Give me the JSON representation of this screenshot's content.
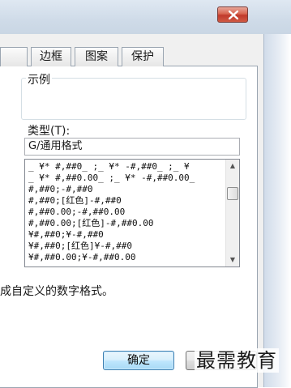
{
  "tabs": {
    "border": "边框",
    "pattern": "图案",
    "protect": "保护"
  },
  "sample": {
    "label": "示例"
  },
  "type_field": {
    "label": "类型(T):",
    "value": "G/通用格式"
  },
  "format_list": {
    "items": [
      "_ ¥* #,##0_ ;_ ¥* -#,##0_ ;_ ¥",
      "_ ¥* #,##0.00_ ;_ ¥* -#,##0.00_",
      "#,##0;-#,##0",
      "#,##0;[红色]-#,##0",
      "#,##0.00;-#,##0.00",
      "#,##0.00;[红色]-#,##0.00",
      "¥#,##0;¥-#,##0",
      "¥#,##0;[红色]¥-#,##0",
      "¥#,##0.00;¥-#,##0.00"
    ]
  },
  "description": "成自定义的数字格式。",
  "buttons": {
    "ok": "确定"
  },
  "watermark": "最需教育",
  "colors": {
    "close_button": "#c0392b",
    "ok_button_border": "#3c7fb1",
    "dialog_background": "#f0f0f0"
  },
  "icons": {
    "close": "close-icon",
    "scroll_up": "scroll-up-arrow-icon",
    "scroll_down": "scroll-down-arrow-icon"
  }
}
